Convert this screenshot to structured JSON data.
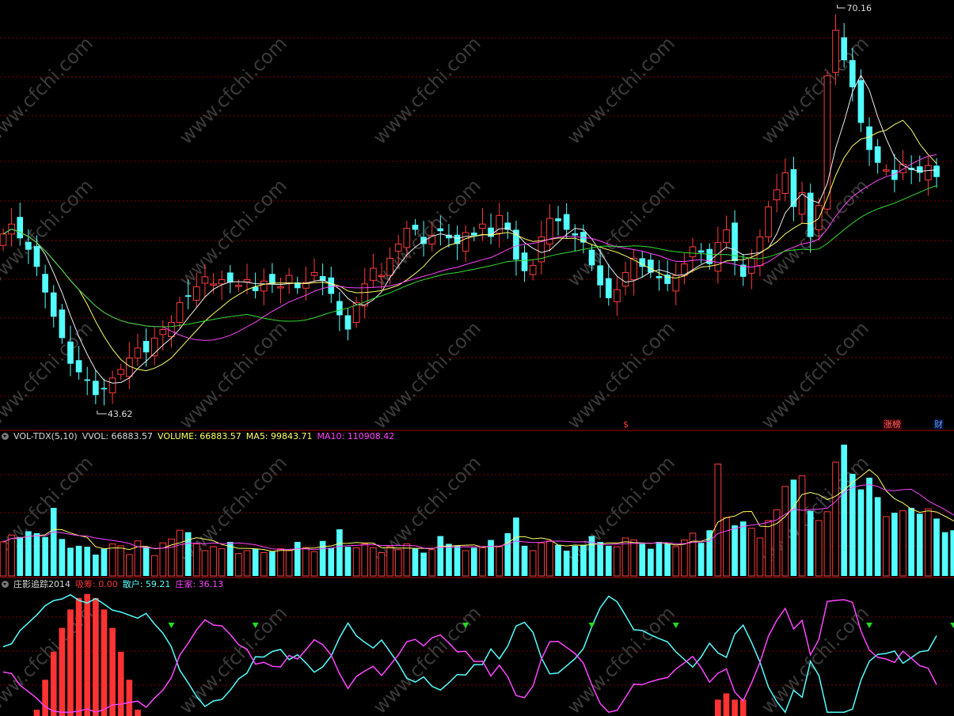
{
  "colors": {
    "up": "#ff3b3b",
    "down": "#54ffff",
    "ma_short": "#ffff66",
    "ma_mid": "#ff44ff",
    "ma_long": "#33dd33",
    "grid": "#7a0000",
    "divider": "#aa0000",
    "text_white": "#d8d8d8",
    "label_red": "#ff3333",
    "label_cyan": "#54ffff",
    "label_magenta": "#ff44ff",
    "label_yellow": "#ffff66",
    "signal_green": "#22dd22"
  },
  "price_panel": {
    "high_label": "70.16",
    "low_label": "43.62",
    "markers": [
      {
        "text": "$",
        "color": "#ff3333",
        "x_index": 120
      },
      {
        "text": "涨榜",
        "color": "#ff6666",
        "x_index": 170
      },
      {
        "text": "财",
        "color": "#6699ff",
        "x_index": 180
      }
    ]
  },
  "volume_panel": {
    "indicator": "VOL-TDX(5,10)",
    "vvol": "VVOL: 66883.57",
    "volume": "VOLUME: 66883.57",
    "ma5": "MA5: 99843.71",
    "ma10": "MA10: 110908.42"
  },
  "indicator_panel": {
    "name": "庄影追踪2014",
    "xichou": "吸筹: 0.00",
    "sanhu": "散户: 59.21",
    "zhuangjia": "庄家: 36.13"
  },
  "watermark": "www.cfchi.com",
  "chart_data": [
    {
      "type": "candlestick",
      "panel": "price",
      "series_description": "Daily candlesticks with moving averages",
      "high": 70.16,
      "low": 43.62,
      "ylim": [
        41.8,
        71.5
      ],
      "close": [
        55.3,
        56.0,
        55.0,
        54.2,
        53.0,
        51.2,
        49.5,
        48.0,
        46.2,
        45.6,
        45.0,
        44.0,
        44.4,
        45.2,
        45.8,
        46.6,
        47.3,
        47.0,
        48.0,
        48.6,
        49.1,
        50.5,
        50.9,
        51.6,
        52.3,
        51.8,
        52.1,
        51.9,
        51.7,
        52.1,
        51.3,
        52.0,
        51.8,
        51.6,
        52.4,
        51.5,
        51.9,
        52.6,
        52.0,
        51.1,
        49.6,
        48.6,
        50.5,
        51.8,
        52.9,
        52.4,
        53.6,
        54.6,
        55.7,
        55.6,
        54.6,
        55.2,
        55.5,
        55.0,
        54.6,
        55.4,
        55.2,
        56.0,
        55.1,
        56.6,
        55.6,
        53.5,
        52.7,
        53.1,
        55.1,
        56.4,
        56.2,
        55.6,
        55.2,
        54.7,
        53.1,
        51.7,
        50.8,
        51.4,
        52.6,
        53.6,
        53.0,
        52.6,
        52.2,
        51.8,
        52.4,
        53.2,
        54.4,
        54.0,
        53.2,
        54.7,
        55.6,
        53.4,
        52.3,
        53.6,
        55.1,
        57.2,
        58.4,
        59.6,
        57.2,
        58.2,
        55.1,
        57.3,
        66.4,
        69.6,
        67.5,
        65.6,
        63.1,
        61.2,
        60.3,
        59.8,
        59.1,
        60.2,
        59.8,
        59.6,
        60.1,
        59.3
      ]
    },
    {
      "type": "bar",
      "panel": "volume",
      "series": [
        {
          "name": "VOLUME",
          "last": 66883.57
        },
        {
          "name": "MA5",
          "last": 99843.71
        },
        {
          "name": "MA10",
          "last": 110908.42
        }
      ],
      "values": [
        3.5,
        4.2,
        4.0,
        4.6,
        4.4,
        4.0,
        7.0,
        3.8,
        2.9,
        3.1,
        3.0,
        2.2,
        2.8,
        3.3,
        3.1,
        2.2,
        3.6,
        3.0,
        2.1,
        3.4,
        3.8,
        4.7,
        4.5,
        3.3,
        2.6,
        3.0,
        2.8,
        3.5,
        2.3,
        2.6,
        2.8,
        2.4,
        2.5,
        2.8,
        2.6,
        3.5,
        2.9,
        2.5,
        3.6,
        2.9,
        4.8,
        3.0,
        2.9,
        3.3,
        2.9,
        2.4,
        3.0,
        2.7,
        3.3,
        2.8,
        2.4,
        2.7,
        4.1,
        3.3,
        3.1,
        2.6,
        2.9,
        2.9,
        3.7,
        3.0,
        4.4,
        6.0,
        3.1,
        2.6,
        3.4,
        3.6,
        3.2,
        2.6,
        3.1,
        3.2,
        4.1,
        3.5,
        3.1,
        3.0,
        3.9,
        3.7,
        3.3,
        2.8,
        3.5,
        3.3,
        3.0,
        3.7,
        4.4,
        3.4,
        4.7,
        11.5,
        6.0,
        5.2,
        5.6,
        4.9,
        3.9,
        5.7,
        6.8,
        9.2,
        9.9,
        10.3,
        6.7,
        5.7,
        6.6,
        11.7,
        13.5,
        10.5,
        8.9,
        10.1,
        8.1,
        6.1,
        6.5,
        6.7,
        7.0,
        6.4,
        6.9,
        5.9,
        4.5,
        4.7,
        5.1
      ],
      "ylim": [
        0,
        13.5
      ]
    },
    {
      "type": "line",
      "panel": "indicator",
      "series": [
        {
          "name": "散户"
        },
        {
          "name": "庄家"
        },
        {
          "name": "吸筹"
        }
      ]
    }
  ]
}
